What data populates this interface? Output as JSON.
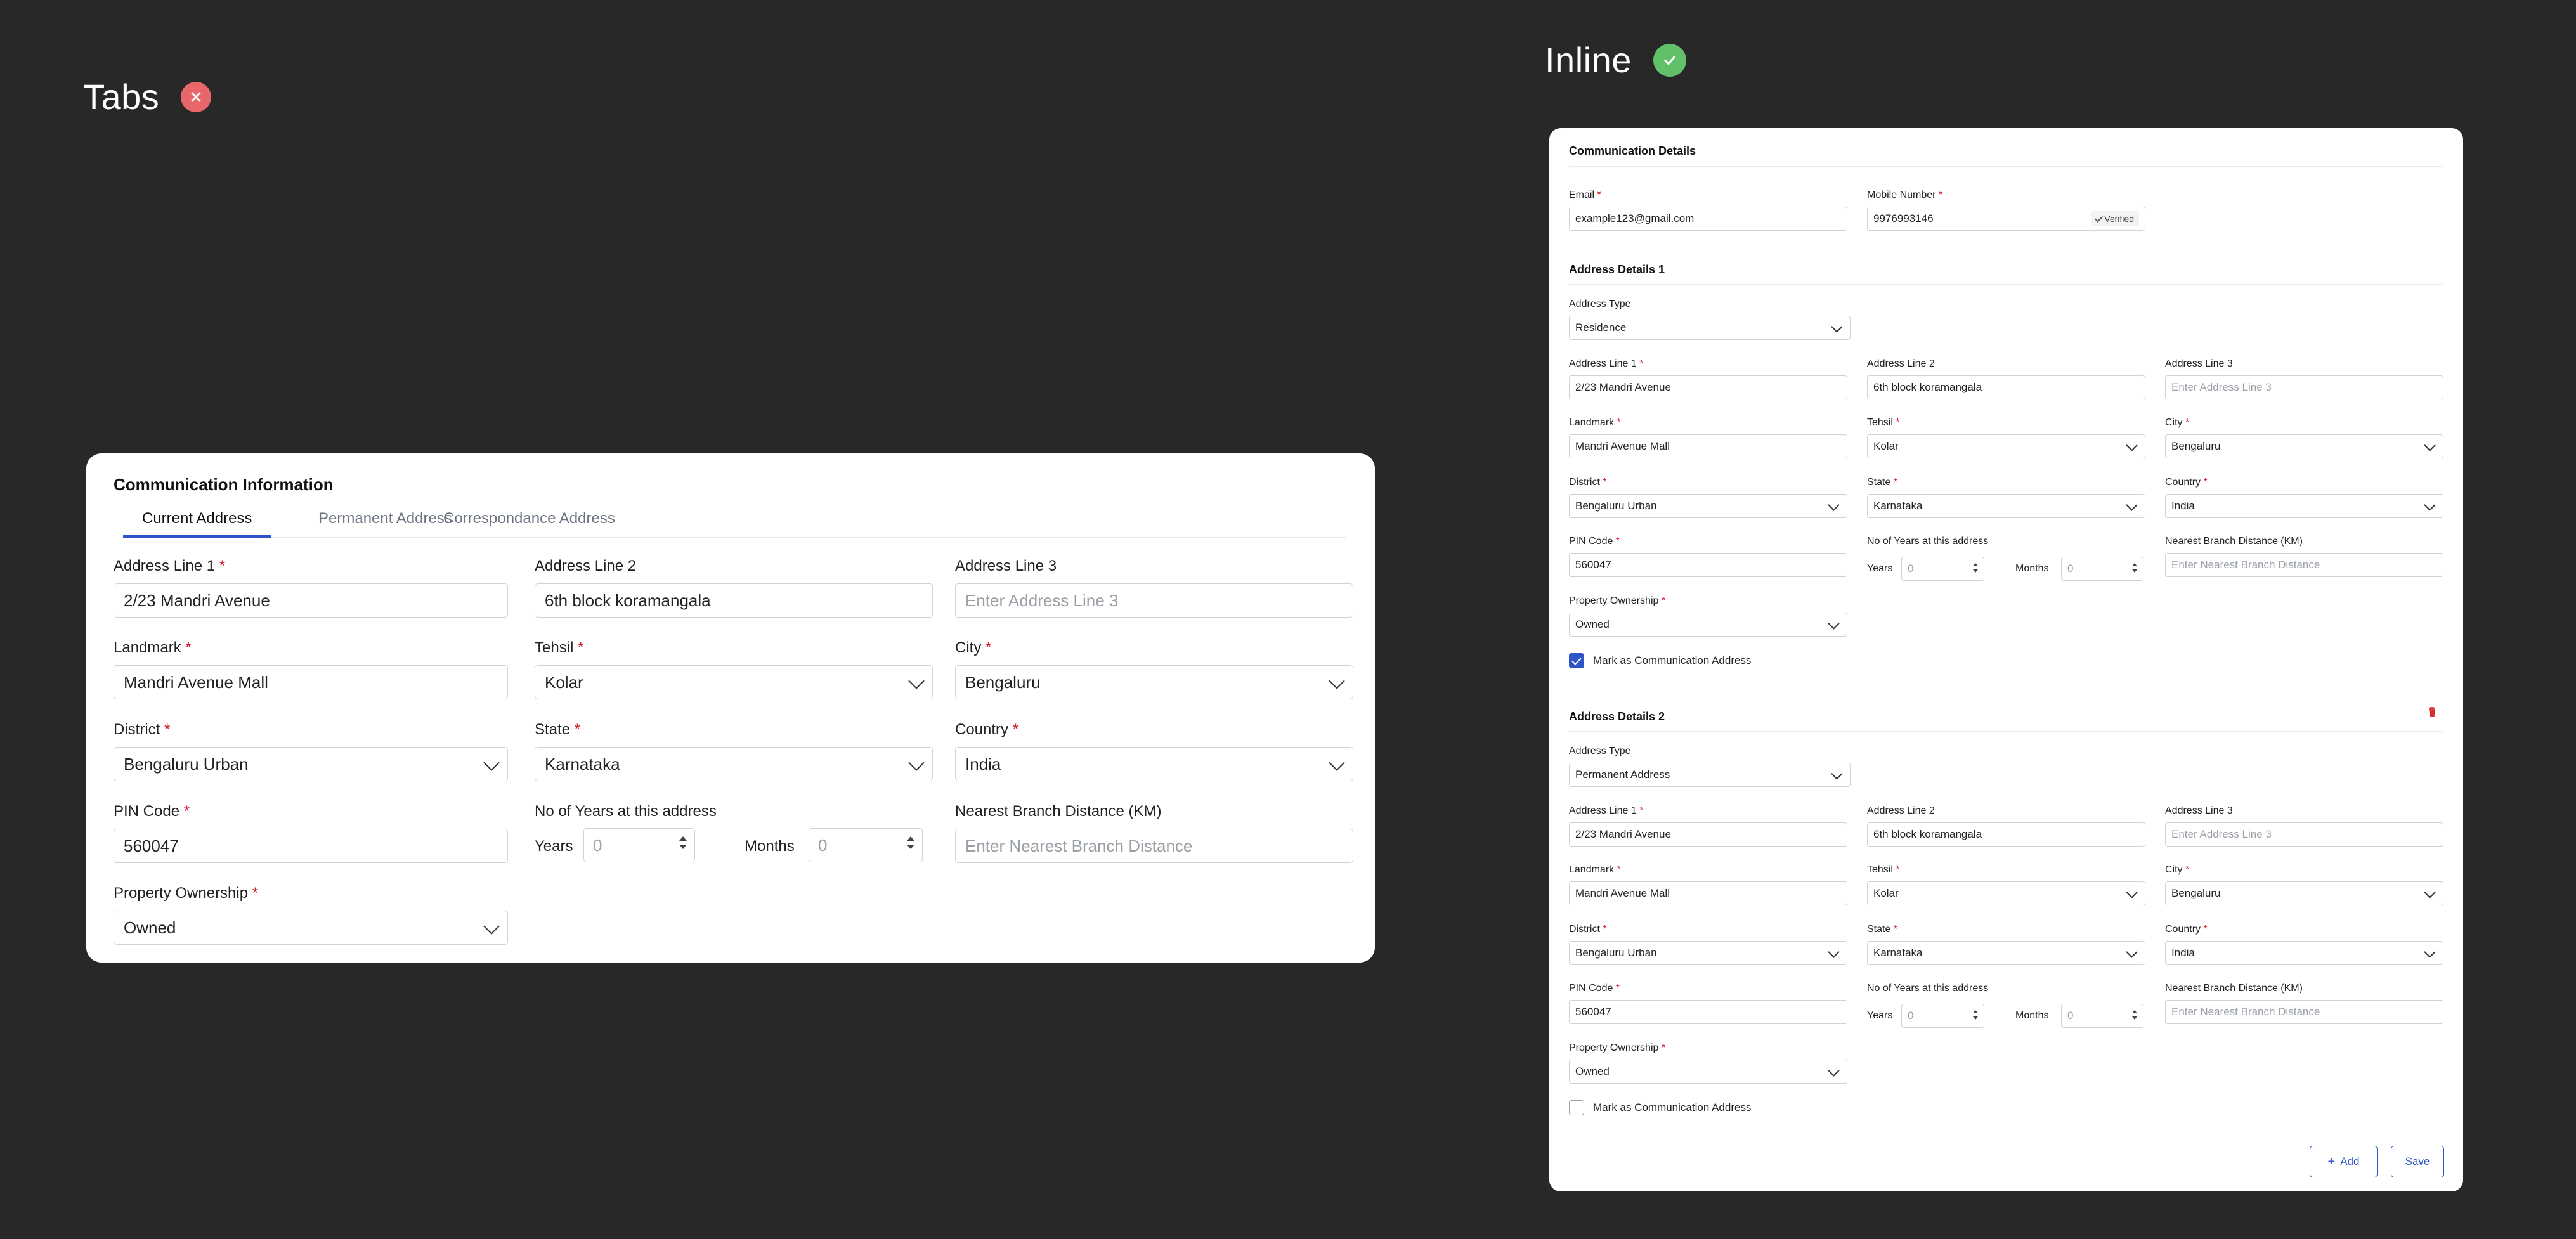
{
  "tabs_heading": {
    "title": "Tabs",
    "status_icon": "x-icon",
    "status_color": "#e8676a"
  },
  "inline_heading": {
    "title": "Inline",
    "status_icon": "check-icon",
    "status_color": "#62c06b"
  },
  "tabs_card": {
    "title": "Communication Information",
    "tabs": [
      "Current Address",
      "Permanent Address",
      "Correspondance Address"
    ],
    "active_tab": "Current Address",
    "accent_color": "#2e55c8",
    "fields": {
      "address_line_1": {
        "label": "Address Line 1",
        "value": "2/23 Mandri Avenue"
      },
      "address_line_2": {
        "label": "Address Line 2",
        "value": "6th block koramangala"
      },
      "address_line_3": {
        "label": "Address Line 3",
        "placeholder": "Enter Address Line 3"
      },
      "landmark": {
        "label": "Landmark",
        "value": "Mandri Avenue Mall"
      },
      "tehsil": {
        "label": "Tehsil",
        "value": "Kolar"
      },
      "city": {
        "label": "City",
        "value": "Bengaluru"
      },
      "district": {
        "label": "District",
        "value": "Bengaluru Urban"
      },
      "state": {
        "label": "State",
        "value": "Karnataka"
      },
      "country": {
        "label": "Country",
        "value": "India"
      },
      "pin_code": {
        "label": "PIN Code",
        "value": "560047"
      },
      "years_at_address": {
        "label": "No of Years at this address",
        "years_label": "Years",
        "years_placeholder": "0",
        "months_label": "Months",
        "months_placeholder": "0"
      },
      "branch_distance": {
        "label": "Nearest Branch Distance (KM)",
        "placeholder": "Enter Nearest Branch Distance"
      },
      "property_ownership": {
        "label": "Property Ownership",
        "value": "Owned"
      }
    }
  },
  "inline_card": {
    "communication": {
      "title": "Communication Details",
      "email": {
        "label": "Email",
        "value": "example123@gmail.com"
      },
      "mobile": {
        "label": "Mobile Number",
        "value": "9976993146",
        "badge": "Verified"
      }
    },
    "address_1": {
      "title": "Address Details 1",
      "address_type": {
        "label": "Address Type",
        "value": "Residence"
      },
      "address_line_1": {
        "label": "Address Line 1",
        "value": "2/23 Mandri Avenue"
      },
      "address_line_2": {
        "label": "Address Line 2",
        "value": "6th block koramangala"
      },
      "address_line_3": {
        "label": "Address Line 3",
        "placeholder": "Enter Address Line 3"
      },
      "landmark": {
        "label": "Landmark",
        "value": "Mandri Avenue Mall"
      },
      "tehsil": {
        "label": "Tehsil",
        "value": "Kolar"
      },
      "city": {
        "label": "City",
        "value": "Bengaluru"
      },
      "district": {
        "label": "District",
        "value": "Bengaluru Urban"
      },
      "state": {
        "label": "State",
        "value": "Karnataka"
      },
      "country": {
        "label": "Country",
        "value": "India"
      },
      "pin_code": {
        "label": "PIN Code",
        "value": "560047"
      },
      "years_at_address": {
        "label": "No of Years at this address",
        "years_label": "Years",
        "years_placeholder": "0",
        "months_label": "Months",
        "months_placeholder": "0"
      },
      "branch_distance": {
        "label": "Nearest Branch Distance (KM)",
        "placeholder": "Enter Nearest Branch Distance"
      },
      "property_ownership": {
        "label": "Property Ownership",
        "value": "Owned"
      },
      "mark_communication": {
        "label": "Mark as Communication Address",
        "checked": true
      }
    },
    "address_2": {
      "title": "Address Details 2",
      "delete_icon": "trash-icon",
      "delete_color": "#d92d2d",
      "address_type": {
        "label": "Address Type",
        "value": "Permanent Address"
      },
      "address_line_1": {
        "label": "Address Line 1",
        "value": "2/23 Mandri Avenue"
      },
      "address_line_2": {
        "label": "Address Line 2",
        "value": "6th block koramangala"
      },
      "address_line_3": {
        "label": "Address Line 3",
        "placeholder": "Enter Address Line 3"
      },
      "landmark": {
        "label": "Landmark",
        "value": "Mandri Avenue Mall"
      },
      "tehsil": {
        "label": "Tehsil",
        "value": "Kolar"
      },
      "city": {
        "label": "City",
        "value": "Bengaluru"
      },
      "district": {
        "label": "District",
        "value": "Bengaluru Urban"
      },
      "state": {
        "label": "State",
        "value": "Karnataka"
      },
      "country": {
        "label": "Country",
        "value": "India"
      },
      "pin_code": {
        "label": "PIN Code",
        "value": "560047"
      },
      "years_at_address": {
        "label": "No of Years at this address",
        "years_label": "Years",
        "years_placeholder": "0",
        "months_label": "Months",
        "months_placeholder": "0"
      },
      "branch_distance": {
        "label": "Nearest Branch Distance (KM)",
        "placeholder": "Enter Nearest Branch Distance"
      },
      "property_ownership": {
        "label": "Property Ownership",
        "value": "Owned"
      },
      "mark_communication": {
        "label": "Mark as Communication Address",
        "checked": false
      }
    },
    "actions": {
      "add_label": "Add",
      "save_label": "Save"
    }
  }
}
